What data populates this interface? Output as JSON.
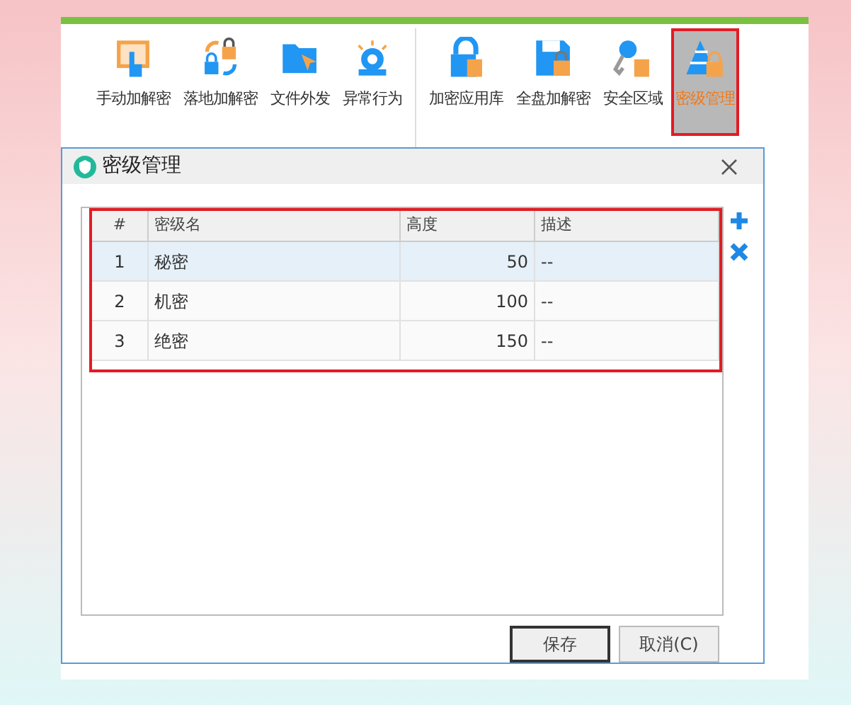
{
  "ribbon": {
    "items": [
      {
        "label": "手动加解密",
        "kind": "touch",
        "selected": false
      },
      {
        "label": "落地加解密",
        "kind": "swap",
        "selected": false
      },
      {
        "label": "文件外发",
        "kind": "folder",
        "selected": false
      },
      {
        "label": "异常行为",
        "kind": "alarm",
        "selected": false
      },
      {
        "label": "加密应用库",
        "kind": "lock",
        "selected": false
      },
      {
        "label": "全盘加解密",
        "kind": "disk",
        "selected": false
      },
      {
        "label": "安全区域",
        "kind": "key",
        "selected": false
      },
      {
        "label": "密级管理",
        "kind": "pyramid",
        "selected": true
      }
    ]
  },
  "dialog": {
    "title": "密级管理",
    "table": {
      "columns": [
        "#",
        "密级名",
        "高度",
        "描述"
      ],
      "rows": [
        {
          "cells": [
            "1",
            "秘密",
            "50",
            "--"
          ],
          "selected": true
        },
        {
          "cells": [
            "2",
            "机密",
            "100",
            "--"
          ],
          "selected": false
        },
        {
          "cells": [
            "3",
            "绝密",
            "150",
            "--"
          ],
          "selected": false
        }
      ]
    },
    "buttons": [
      {
        "label": "保存",
        "default": true
      },
      {
        "label": "取消(C)",
        "default": false
      }
    ]
  }
}
